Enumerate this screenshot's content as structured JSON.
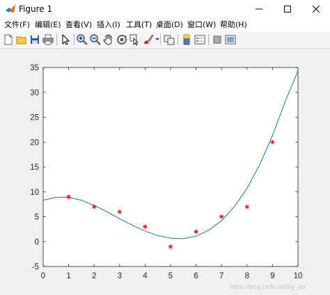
{
  "window": {
    "title": "Figure 1"
  },
  "menu": [
    {
      "label": "文件(F)"
    },
    {
      "label": "编辑(E)"
    },
    {
      "label": "查看(V)"
    },
    {
      "label": "插入(I)"
    },
    {
      "label": "工具(T)"
    },
    {
      "label": "桌面(D)"
    },
    {
      "label": "窗口(W)"
    },
    {
      "label": "帮助(H)"
    }
  ],
  "toolbar": {
    "icons": [
      "new-figure-icon",
      "open-file-icon",
      "save-icon",
      "print-icon",
      "pointer-icon",
      "zoom-in-icon",
      "zoom-out-icon",
      "pan-icon",
      "rotate-3d-icon",
      "data-cursor-icon",
      "brush-icon",
      "link-plot-icon",
      "colorbar-icon",
      "legend-icon",
      "hide-plot-tools-icon",
      "show-plot-tools-icon"
    ]
  },
  "watermark": "https://blog.csdn.net/lily_oo",
  "chart_data": {
    "type": "scatter",
    "title": "",
    "xlabel": "",
    "ylabel": "",
    "xlim": [
      0,
      10
    ],
    "ylim": [
      -5,
      35
    ],
    "x_ticks": [
      0,
      1,
      2,
      3,
      4,
      5,
      6,
      7,
      8,
      9,
      10
    ],
    "y_ticks": [
      -5,
      0,
      5,
      10,
      15,
      20,
      25,
      30,
      35
    ],
    "x_tick_labels": [
      "0",
      "1",
      "2",
      "3",
      "4",
      "5",
      "6",
      "7",
      "8",
      "9",
      "10"
    ],
    "y_tick_labels": [
      "-5",
      "0",
      "5",
      "10",
      "15",
      "20",
      "25",
      "30",
      "35"
    ],
    "grid": false,
    "series": [
      {
        "kind": "markers",
        "marker": "asterisk",
        "color": "#ff0000",
        "x": [
          1,
          2,
          3,
          4,
          5,
          6,
          7,
          8,
          9
        ],
        "y": [
          9,
          7,
          6,
          3,
          -1,
          2,
          5,
          7,
          20
        ]
      },
      {
        "kind": "line",
        "color": "#1f77b4",
        "x": [
          0,
          0.5,
          1,
          1.5,
          2,
          2.5,
          3,
          3.5,
          4,
          4.5,
          5,
          5.5,
          6,
          6.5,
          7,
          7.5,
          8,
          8.5,
          9,
          9.5,
          10
        ],
        "y": [
          8.3,
          8.9,
          8.9,
          8.3,
          7.3,
          6.0,
          4.6,
          3.3,
          2.1,
          1.2,
          0.7,
          0.6,
          1.1,
          2.3,
          4.2,
          7.0,
          10.7,
          15.5,
          21.3,
          28.2,
          34.3
        ]
      }
    ]
  }
}
